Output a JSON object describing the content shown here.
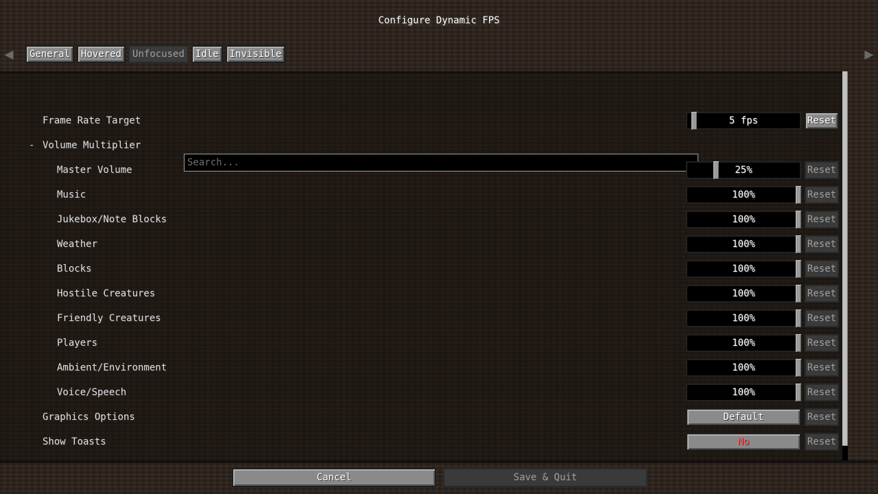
{
  "window": {
    "title": "Configure Dynamic FPS"
  },
  "tabs": [
    {
      "label": "General",
      "state": "normal"
    },
    {
      "label": "Hovered",
      "state": "normal"
    },
    {
      "label": "Unfocused",
      "state": "selected"
    },
    {
      "label": "Idle",
      "state": "normal"
    },
    {
      "label": "Invisible",
      "state": "normal"
    }
  ],
  "nav": {
    "left_icon": "arrow-left-icon",
    "right_icon": "arrow-right-icon"
  },
  "search": {
    "placeholder": "Search..."
  },
  "entries": {
    "frame_rate": {
      "label": "Frame Rate Target",
      "value": "5 fps",
      "slider_fraction": 0.05,
      "reset": "Reset",
      "reset_enabled": true
    },
    "volume_group": {
      "label": "Volume Multiplier",
      "toggle": "-"
    },
    "volumes": [
      {
        "label": "Master Volume",
        "value": "25%",
        "fraction": 0.25,
        "reset": "Reset"
      },
      {
        "label": "Music",
        "value": "100%",
        "fraction": 1.0,
        "reset": "Reset"
      },
      {
        "label": "Jukebox/Note Blocks",
        "value": "100%",
        "fraction": 1.0,
        "reset": "Reset"
      },
      {
        "label": "Weather",
        "value": "100%",
        "fraction": 1.0,
        "reset": "Reset"
      },
      {
        "label": "Blocks",
        "value": "100%",
        "fraction": 1.0,
        "reset": "Reset"
      },
      {
        "label": "Hostile Creatures",
        "value": "100%",
        "fraction": 1.0,
        "reset": "Reset"
      },
      {
        "label": "Friendly Creatures",
        "value": "100%",
        "fraction": 1.0,
        "reset": "Reset"
      },
      {
        "label": "Players",
        "value": "100%",
        "fraction": 1.0,
        "reset": "Reset"
      },
      {
        "label": "Ambient/Environment",
        "value": "100%",
        "fraction": 1.0,
        "reset": "Reset"
      },
      {
        "label": "Voice/Speech",
        "value": "100%",
        "fraction": 1.0,
        "reset": "Reset"
      }
    ],
    "graphics": {
      "label": "Graphics Options",
      "value": "Default",
      "reset": "Reset"
    },
    "toasts": {
      "label": "Show Toasts",
      "value": "No",
      "reset": "Reset"
    }
  },
  "footer": {
    "cancel": "Cancel",
    "save": "Save & Quit"
  },
  "colors": {
    "no_value": "#ff5555",
    "button_face": "#8a8a8a",
    "disabled_face": "#3a3a3a"
  }
}
